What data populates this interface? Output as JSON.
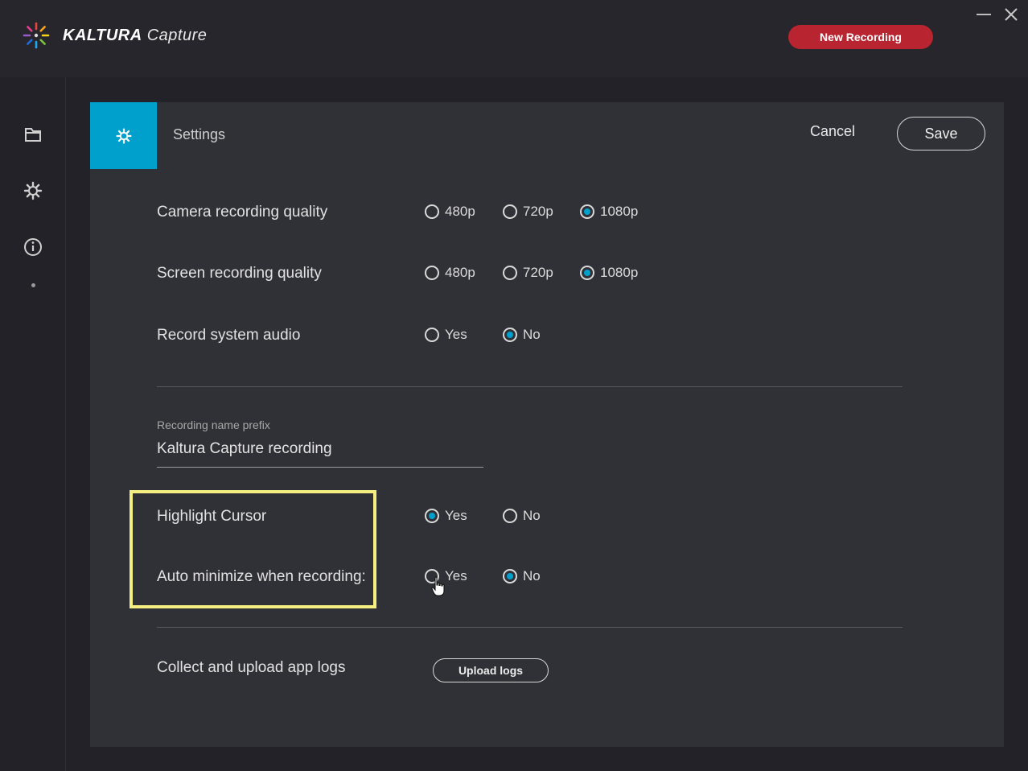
{
  "app": {
    "brand_bold": "KALTURA",
    "brand_light": "Capture",
    "new_recording_label": "New Recording"
  },
  "sidebar": {
    "items": [
      {
        "icon": "folder-icon"
      },
      {
        "icon": "gear-icon"
      },
      {
        "icon": "info-icon"
      }
    ]
  },
  "panel": {
    "title": "Settings",
    "cancel_label": "Cancel",
    "save_label": "Save"
  },
  "settings": {
    "camera_quality": {
      "label": "Camera recording quality",
      "options": [
        "480p",
        "720p",
        "1080p"
      ],
      "selected": "1080p"
    },
    "screen_quality": {
      "label": "Screen recording quality",
      "options": [
        "480p",
        "720p",
        "1080p"
      ],
      "selected": "1080p"
    },
    "system_audio": {
      "label": "Record system audio",
      "options": [
        "Yes",
        "No"
      ],
      "selected": "No"
    },
    "name_prefix": {
      "label": "Recording name prefix",
      "value": "Kaltura Capture recording"
    },
    "highlight_cursor": {
      "label": "Highlight Cursor",
      "options": [
        "Yes",
        "No"
      ],
      "selected": "Yes"
    },
    "auto_minimize": {
      "label": "Auto minimize when recording:",
      "options": [
        "Yes",
        "No"
      ],
      "selected": "No"
    },
    "logs": {
      "label": "Collect and upload app logs",
      "button_label": "Upload logs"
    }
  },
  "colors": {
    "accent": "#00a0cc",
    "record_red": "#b8242f",
    "highlight": "#f5ef82"
  }
}
